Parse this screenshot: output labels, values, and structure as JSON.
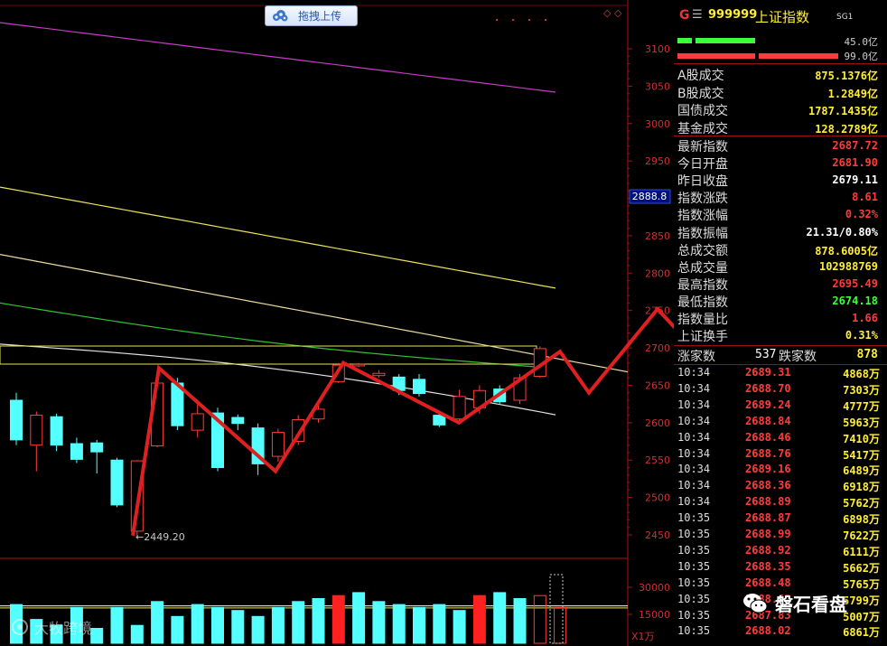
{
  "toolbar": {
    "upload_label": "拖拽上传",
    "corner_icons": "◇ ◇"
  },
  "chart_data": {
    "type": "candlestick",
    "title": "",
    "y_axis": {
      "ticks": [
        3100,
        3050,
        3000,
        2950,
        2900,
        2850,
        2800,
        2750,
        2700,
        2650,
        2600,
        2550,
        2500,
        2450
      ],
      "range": [
        2420,
        3120
      ]
    },
    "current_price_label": "2888.8",
    "low_annotation": "2449.20",
    "volume_axis": {
      "ticks": [
        "30000",
        "15000"
      ],
      "unit": "X1万"
    },
    "candles": [
      {
        "o": 2630,
        "c": 2577,
        "h": 2640,
        "l": 2570
      },
      {
        "o": 2570,
        "c": 2610,
        "h": 2615,
        "l": 2535
      },
      {
        "o": 2608,
        "c": 2570,
        "h": 2612,
        "l": 2562
      },
      {
        "o": 2572,
        "c": 2551,
        "h": 2580,
        "l": 2546
      },
      {
        "o": 2573,
        "c": 2561,
        "h": 2577,
        "l": 2532
      },
      {
        "o": 2550,
        "c": 2490,
        "h": 2553,
        "l": 2487
      },
      {
        "o": 2455,
        "c": 2549,
        "h": 2550,
        "l": 2449
      },
      {
        "o": 2569,
        "c": 2653,
        "h": 2670,
        "l": 2567
      },
      {
        "o": 2653,
        "c": 2596,
        "h": 2660,
        "l": 2590
      },
      {
        "o": 2590,
        "c": 2612,
        "h": 2625,
        "l": 2580
      },
      {
        "o": 2613,
        "c": 2540,
        "h": 2620,
        "l": 2535
      },
      {
        "o": 2607,
        "c": 2599,
        "h": 2611,
        "l": 2590
      },
      {
        "o": 2593,
        "c": 2545,
        "h": 2599,
        "l": 2530
      },
      {
        "o": 2555,
        "c": 2587,
        "h": 2592,
        "l": 2548
      },
      {
        "o": 2575,
        "c": 2604,
        "h": 2610,
        "l": 2570
      },
      {
        "o": 2605,
        "c": 2618,
        "h": 2625,
        "l": 2600
      },
      {
        "o": 2655,
        "c": 2677,
        "h": 2680,
        "l": 2653
      },
      {
        "o": 2676,
        "c": 2678,
        "h": 2680,
        "l": 2674
      },
      {
        "o": 2663,
        "c": 2666,
        "h": 2670,
        "l": 2660
      },
      {
        "o": 2661,
        "c": 2643,
        "h": 2665,
        "l": 2637
      },
      {
        "o": 2658,
        "c": 2639,
        "h": 2665,
        "l": 2635
      },
      {
        "o": 2610,
        "c": 2597,
        "h": 2615,
        "l": 2594
      },
      {
        "o": 2605,
        "c": 2635,
        "h": 2644,
        "l": 2600
      },
      {
        "o": 2620,
        "c": 2643,
        "h": 2650,
        "l": 2612
      },
      {
        "o": 2645,
        "c": 2628,
        "h": 2650,
        "l": 2624
      },
      {
        "o": 2630,
        "c": 2660,
        "h": 2665,
        "l": 2625
      },
      {
        "o": 2662,
        "c": 2699,
        "h": 2702,
        "l": 2660
      }
    ],
    "moving_averages": [
      {
        "name": "MA-magenta",
        "color": "#c43cc4",
        "from": 3135,
        "to": 3042
      },
      {
        "name": "MA-yellow",
        "color": "#e8e05a",
        "from": 2915,
        "to": 2780
      },
      {
        "name": "MA-pale",
        "color": "#e8d8a0",
        "from": 2825,
        "to": 2668
      },
      {
        "name": "MA-green",
        "color": "#33c033",
        "from": 2760,
        "to": 2675
      },
      {
        "name": "MA-white",
        "color": "#e0e0e0",
        "from": 2705,
        "to": 2618
      }
    ],
    "overlay_line_points": [
      2449,
      2673,
      2535,
      2680,
      2600,
      2695,
      2640,
      2752,
      2550
    ],
    "volumes": [
      13,
      8,
      6,
      12,
      5,
      12,
      6,
      14,
      9,
      13,
      12,
      11,
      9,
      12,
      14,
      15,
      16,
      17,
      14,
      13,
      12,
      13,
      11,
      16,
      17,
      15,
      16,
      12
    ]
  },
  "panel": {
    "market_flag": "G",
    "icon_name": "grid-icon",
    "code": "999999",
    "name": "上证指数",
    "badge": "SG1",
    "bar1_value": "45.0亿",
    "bar2_value": "99.0亿",
    "turnover": [
      {
        "label": "A股成交",
        "value": "875.1376亿"
      },
      {
        "label": "B股成交",
        "value": "1.2849亿"
      },
      {
        "label": "国债成交",
        "value": "1787.1435亿"
      },
      {
        "label": "基金成交",
        "value": "128.2789亿"
      }
    ],
    "stats": [
      {
        "label": "最新指数",
        "value": "2687.72",
        "color": "#ff3c3c"
      },
      {
        "label": "今日开盘",
        "value": "2681.90",
        "color": "#ff3c3c"
      },
      {
        "label": "昨日收盘",
        "value": "2679.11",
        "color": "#ffffff"
      },
      {
        "label": "指数涨跌",
        "value": "8.61",
        "color": "#ff3c3c"
      },
      {
        "label": "指数涨幅",
        "value": "0.32%",
        "color": "#ff3c3c"
      },
      {
        "label": "指数振幅",
        "value": "21.31/0.80%",
        "color": "#ffffff"
      },
      {
        "label": "总成交额",
        "value": "878.6005亿",
        "color": "#ffee33"
      },
      {
        "label": "总成交量",
        "value": "102988769",
        "color": "#ffee33"
      },
      {
        "label": "最高指数",
        "value": "2695.49",
        "color": "#ff3c3c"
      },
      {
        "label": "最低指数",
        "value": "2674.18",
        "color": "#3cff3c"
      },
      {
        "label": "指数量比",
        "value": "1.66",
        "color": "#ff3c3c"
      },
      {
        "label": "上证换手",
        "value": "0.31%",
        "color": "#ffee33"
      }
    ],
    "up_label": "涨家数",
    "up_count": "537",
    "down_label": "跌家数",
    "down_count": "878",
    "ticks": [
      {
        "time": "10:34",
        "price": "2689.31",
        "vol": "4868万"
      },
      {
        "time": "10:34",
        "price": "2688.70",
        "vol": "7303万"
      },
      {
        "time": "10:34",
        "price": "2689.24",
        "vol": "4777万"
      },
      {
        "time": "10:34",
        "price": "2688.84",
        "vol": "5963万"
      },
      {
        "time": "10:34",
        "price": "2688.46",
        "vol": "7410万"
      },
      {
        "time": "10:34",
        "price": "2688.76",
        "vol": "5417万"
      },
      {
        "time": "10:34",
        "price": "2689.16",
        "vol": "6489万"
      },
      {
        "time": "10:34",
        "price": "2688.36",
        "vol": "6918万"
      },
      {
        "time": "10:34",
        "price": "2688.89",
        "vol": "5762万"
      },
      {
        "time": "10:35",
        "price": "2688.87",
        "vol": "6898万"
      },
      {
        "time": "10:35",
        "price": "2688.99",
        "vol": "7622万"
      },
      {
        "time": "10:35",
        "price": "2688.92",
        "vol": "6111万"
      },
      {
        "time": "10:35",
        "price": "2688.35",
        "vol": "5662万"
      },
      {
        "time": "10:35",
        "price": "2688.48",
        "vol": "5765万"
      },
      {
        "time": "10:35",
        "price": "2688.42",
        "vol": "5799万"
      },
      {
        "time": "10:35",
        "price": "2687.83",
        "vol": "5007万"
      },
      {
        "time": "10:35",
        "price": "2688.02",
        "vol": "6861万"
      }
    ]
  },
  "watermark": {
    "right_text": "磐石看盘",
    "left_text": "大牧跨境"
  }
}
